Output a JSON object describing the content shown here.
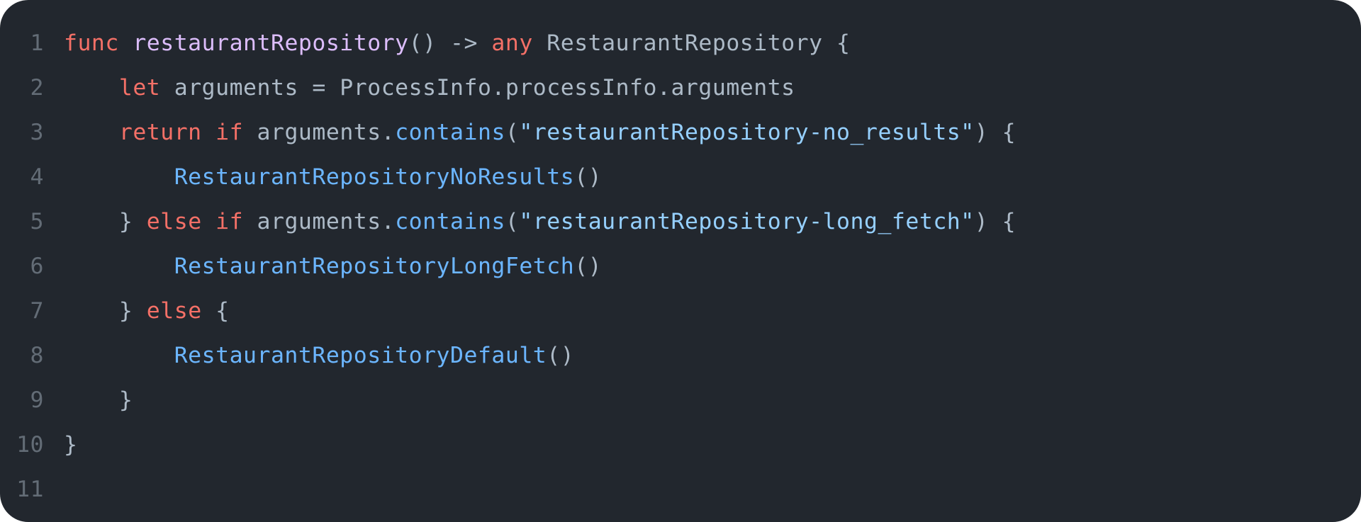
{
  "colors": {
    "background": "#22272e",
    "text": "#adbac7",
    "gutter": "#636c76",
    "keyword": "#f47067",
    "funcName": "#dcbdfb",
    "call": "#6cb6ff",
    "string": "#96d0ff"
  },
  "lines": [
    {
      "num": "1",
      "indent": "",
      "tokens": [
        {
          "c": "kw",
          "t": "func"
        },
        {
          "c": "def",
          "t": " "
        },
        {
          "c": "fn",
          "t": "restaurantRepository"
        },
        {
          "c": "def",
          "t": "() -> "
        },
        {
          "c": "kw",
          "t": "any"
        },
        {
          "c": "def",
          "t": " RestaurantRepository {"
        }
      ]
    },
    {
      "num": "2",
      "indent": "    ",
      "tokens": [
        {
          "c": "kw",
          "t": "let"
        },
        {
          "c": "def",
          "t": " arguments = ProcessInfo.processInfo.arguments"
        }
      ]
    },
    {
      "num": "3",
      "indent": "    ",
      "tokens": [
        {
          "c": "kw",
          "t": "return"
        },
        {
          "c": "def",
          "t": " "
        },
        {
          "c": "kw",
          "t": "if"
        },
        {
          "c": "def",
          "t": " arguments."
        },
        {
          "c": "call",
          "t": "contains"
        },
        {
          "c": "def",
          "t": "("
        },
        {
          "c": "str",
          "t": "\"restaurantRepository-no_results\""
        },
        {
          "c": "def",
          "t": ") {"
        }
      ]
    },
    {
      "num": "4",
      "indent": "        ",
      "tokens": [
        {
          "c": "call",
          "t": "RestaurantRepositoryNoResults"
        },
        {
          "c": "def",
          "t": "()"
        }
      ]
    },
    {
      "num": "5",
      "indent": "    ",
      "tokens": [
        {
          "c": "def",
          "t": "} "
        },
        {
          "c": "kw",
          "t": "else"
        },
        {
          "c": "def",
          "t": " "
        },
        {
          "c": "kw",
          "t": "if"
        },
        {
          "c": "def",
          "t": " arguments."
        },
        {
          "c": "call",
          "t": "contains"
        },
        {
          "c": "def",
          "t": "("
        },
        {
          "c": "str",
          "t": "\"restaurantRepository-long_fetch\""
        },
        {
          "c": "def",
          "t": ") {"
        }
      ]
    },
    {
      "num": "6",
      "indent": "        ",
      "tokens": [
        {
          "c": "call",
          "t": "RestaurantRepositoryLongFetch"
        },
        {
          "c": "def",
          "t": "()"
        }
      ]
    },
    {
      "num": "7",
      "indent": "    ",
      "tokens": [
        {
          "c": "def",
          "t": "} "
        },
        {
          "c": "kw",
          "t": "else"
        },
        {
          "c": "def",
          "t": " {"
        }
      ]
    },
    {
      "num": "8",
      "indent": "        ",
      "tokens": [
        {
          "c": "call",
          "t": "RestaurantRepositoryDefault"
        },
        {
          "c": "def",
          "t": "()"
        }
      ]
    },
    {
      "num": "9",
      "indent": "    ",
      "tokens": [
        {
          "c": "def",
          "t": "}"
        }
      ]
    },
    {
      "num": "10",
      "indent": "",
      "tokens": [
        {
          "c": "def",
          "t": "}"
        }
      ]
    },
    {
      "num": "11",
      "indent": "",
      "tokens": []
    }
  ]
}
